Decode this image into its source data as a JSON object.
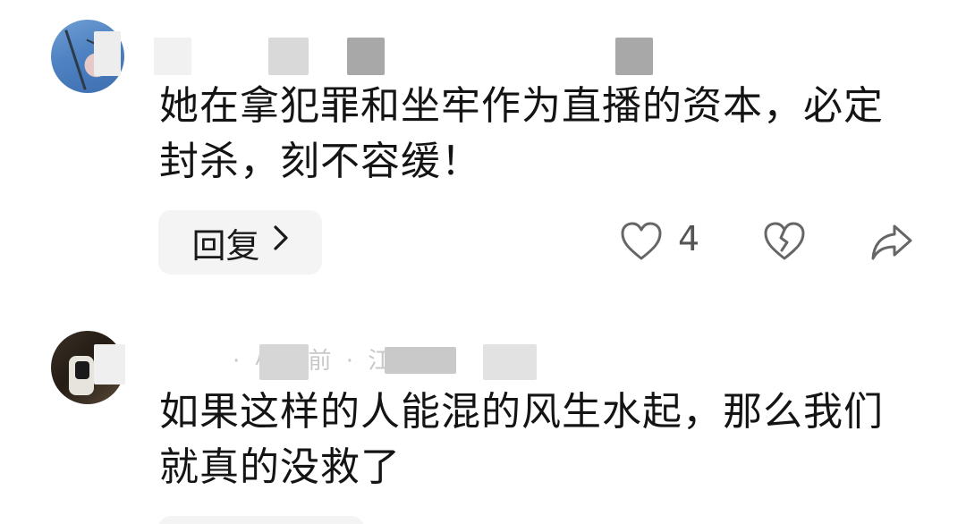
{
  "comments": [
    {
      "text": "她在拿犯罪和坐牢作为直播的资本，必定封杀，刻不容缓！",
      "reply_label": "回复",
      "likes": "4",
      "icons": {
        "like": "heart-icon",
        "dislike": "broken-heart-icon",
        "share": "share-icon",
        "chevron": "chevron-right-icon"
      }
    },
    {
      "meta_partial": "· 小时前 · 江苏",
      "text": "如果这样的人能混的风生水起，那么我们就真的没救了"
    }
  ],
  "colors": {
    "text": "#141414",
    "button_bg": "#f4f4f4",
    "icon": "#666666"
  }
}
